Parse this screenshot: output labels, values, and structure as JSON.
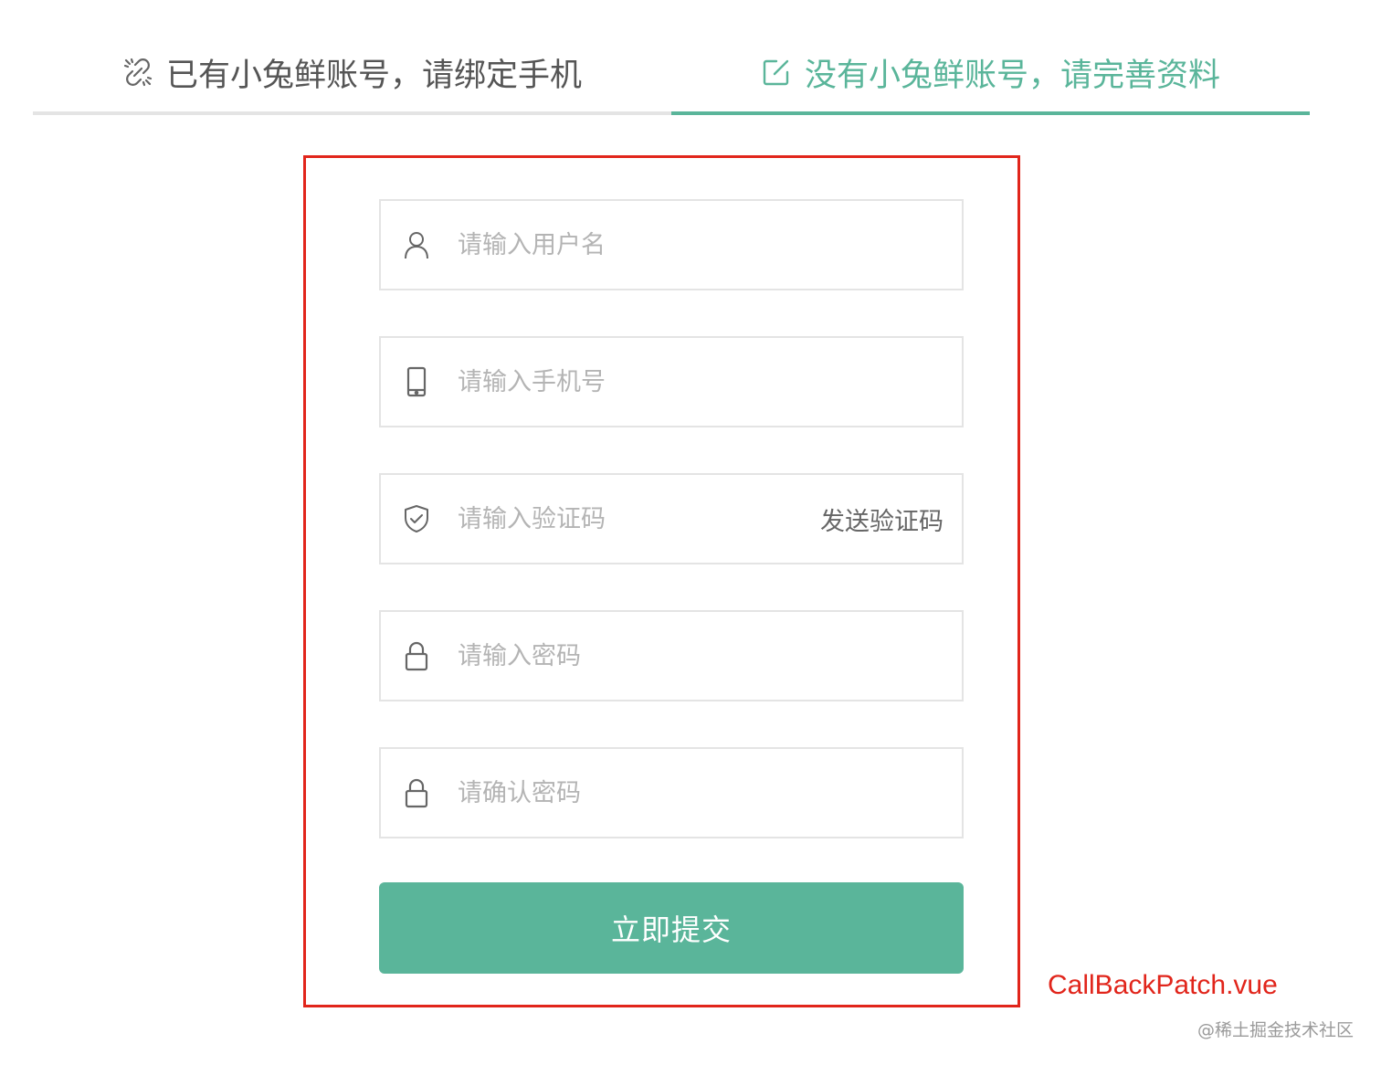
{
  "tabs": [
    {
      "label": "已有小兔鲜账号，请绑定手机",
      "icon": "unlink-icon",
      "active": false
    },
    {
      "label": "没有小兔鲜账号，请完善资料",
      "icon": "edit-icon",
      "active": true
    }
  ],
  "form": {
    "username": {
      "placeholder": "请输入用户名",
      "icon": "user-icon",
      "value": ""
    },
    "mobile": {
      "placeholder": "请输入手机号",
      "icon": "phone-icon",
      "value": ""
    },
    "code": {
      "placeholder": "请输入验证码",
      "icon": "shield-icon",
      "value": "",
      "send_label": "发送验证码"
    },
    "password": {
      "placeholder": "请输入密码",
      "icon": "lock-icon",
      "value": ""
    },
    "confirm_password": {
      "placeholder": "请确认密码",
      "icon": "lock-icon",
      "value": ""
    },
    "submit_label": "立即提交"
  },
  "annotation": {
    "filename": "CallBackPatch.vue"
  },
  "watermark": "@稀土掘金技术社区",
  "colors": {
    "accent": "#5ab59a",
    "highlight_border": "#e1251b",
    "annotation_text": "#e1251b"
  }
}
